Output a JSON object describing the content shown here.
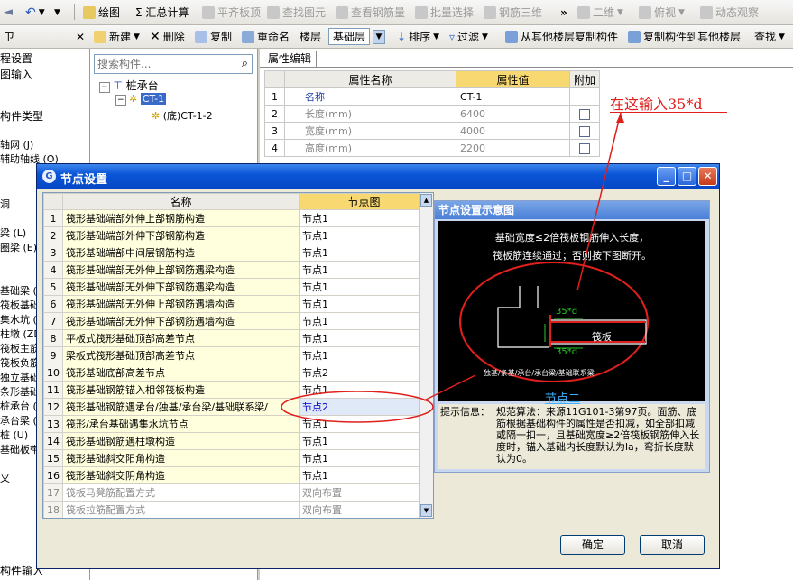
{
  "toolbar1": {
    "items": [
      "绘图",
      "Σ 汇总计算",
      "平齐板顶",
      "查找图元",
      "查看钢筋量",
      "批量选择",
      "钢筋三维",
      "二维",
      "俯视",
      "动态观察"
    ]
  },
  "toolbar2": {
    "items": [
      "新建",
      "删除",
      "复制",
      "重命名",
      "楼层",
      "基础层",
      "排序",
      "过滤",
      "从其他楼层复制构件",
      "复制构件到其他楼层",
      "查找"
    ]
  },
  "left_panel": {
    "items": [
      "程设置",
      "图输入",
      "构件类型",
      "轴网 (J)",
      "辅助轴线 (O)",
      "洞",
      "梁 (L)",
      "圈梁 (E)",
      "基础梁 (",
      "筏板基础",
      "集水坑 (",
      "柱墩 (ZD",
      "筏板主筋",
      "筏板负筋",
      "独立基础",
      "条形基础",
      "桩承台 (",
      "承台梁 (",
      "桩 (U)",
      "基础板带",
      "义",
      "构件输入"
    ]
  },
  "tree": {
    "search_placeholder": "搜索构件...",
    "root": "桩承台",
    "child": "CT-1",
    "grandchild": "(底)CT-1-2"
  },
  "props": {
    "tab": "属性编辑",
    "headers": [
      "属性名称",
      "属性值",
      "附加"
    ],
    "rows": [
      {
        "n": "1",
        "name": "名称",
        "value": "CT-1"
      },
      {
        "n": "2",
        "name": "长度(mm)",
        "value": "6400"
      },
      {
        "n": "3",
        "name": "宽度(mm)",
        "value": "4000"
      },
      {
        "n": "4",
        "name": "高度(mm)",
        "value": "2200"
      }
    ]
  },
  "annotation": "在这输入35*d",
  "dialog": {
    "title": "节点设置",
    "headers": [
      "名称",
      "节点图"
    ],
    "rows": [
      {
        "n": "1",
        "name": "筏形基础端部外伸上部钢筋构造",
        "node": "节点1"
      },
      {
        "n": "2",
        "name": "筏形基础端部外伸下部钢筋构造",
        "node": "节点1"
      },
      {
        "n": "3",
        "name": "筏形基础端部中间层钢筋构造",
        "node": "节点1"
      },
      {
        "n": "4",
        "name": "筏形基础端部无外伸上部钢筋遇梁构造",
        "node": "节点1"
      },
      {
        "n": "5",
        "name": "筏形基础端部无外伸下部钢筋遇梁构造",
        "node": "节点1"
      },
      {
        "n": "6",
        "name": "筏形基础端部无外伸上部钢筋遇墙构造",
        "node": "节点1"
      },
      {
        "n": "7",
        "name": "筏形基础端部无外伸下部钢筋遇墙构造",
        "node": "节点1"
      },
      {
        "n": "8",
        "name": "平板式筏形基础顶部高差节点",
        "node": "节点1"
      },
      {
        "n": "9",
        "name": "梁板式筏形基础顶部高差节点",
        "node": "节点1"
      },
      {
        "n": "10",
        "name": "筏形基础底部高差节点",
        "node": "节点2"
      },
      {
        "n": "11",
        "name": "筏形基础钢筋锚入相邻筏板构造",
        "node": "节点1"
      },
      {
        "n": "12",
        "name": "筏形基础钢筋遇承台/独基/承台梁/基础联系梁/",
        "node": "节点2"
      },
      {
        "n": "13",
        "name": "筏形/承台基础遇集水坑节点",
        "node": "节点1"
      },
      {
        "n": "14",
        "name": "筏形基础钢筋遇柱墩构造",
        "node": "节点1"
      },
      {
        "n": "15",
        "name": "筏形基础斜交阳角构造",
        "node": "节点1"
      },
      {
        "n": "16",
        "name": "筏形基础斜交阴角构造",
        "node": "节点1"
      },
      {
        "n": "17",
        "name": "筏板马凳筋配置方式",
        "node": "双向布置"
      },
      {
        "n": "18",
        "name": "筏板拉筋配置方式",
        "node": "双向布置"
      }
    ],
    "preview": {
      "title": "节点设置示意图",
      "desc1": "基础宽度≤2倍筏板钢筋伸入长度，",
      "desc2": "筏板筋连续通过；否则按下图断开。",
      "dim_top": "35*d",
      "dim_bottom": "35*d",
      "slab_label": "筏板",
      "base_label": "独基/条基/承台/承台梁/基础联系梁",
      "node_link": "节点二",
      "hint_label": "提示信息：",
      "hint_text": "规范算法：来源11G101-3第97页。面筋、底筋根据基础构件的属性是否扣减，如全部扣减或隔一扣一，且基础宽度≥2倍筏板钢筋伸入长度时，锚入基础内长度默认为la，弯折长度默认为0。"
    },
    "ok": "确定",
    "cancel": "取消"
  }
}
